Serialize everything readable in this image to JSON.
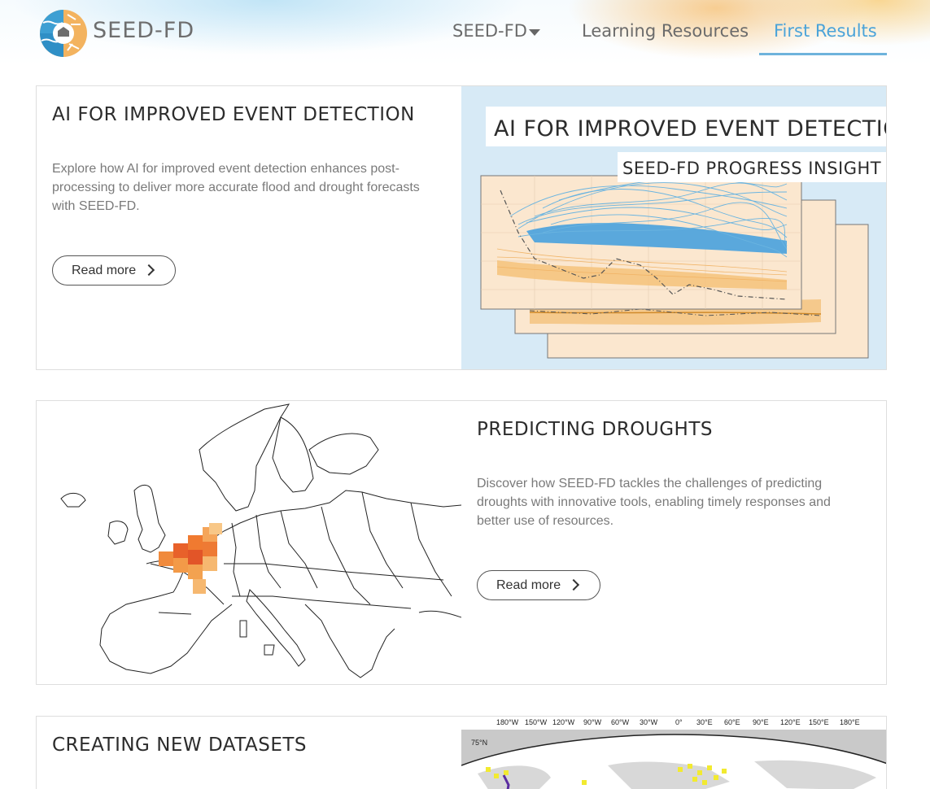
{
  "header": {
    "brand": "SEED-FD",
    "nav": {
      "seedfd_label": "SEED-FD",
      "learning_label": "Learning Resources",
      "first_results_label": "First Results"
    },
    "accent_color": "#4aa3d9"
  },
  "cards": [
    {
      "title": "AI FOR IMPROVED EVENT DETECTION",
      "description": "Explore how AI for improved event detection enhances post-processing to deliver more accurate flood and drought forecasts with SEED-FD.",
      "button_label": "Read more",
      "image": {
        "banner_title": "AI FOR IMPROVED EVENT DETECTION",
        "banner_subtitle": "SEED-FD PROGRESS INSIGHT"
      }
    },
    {
      "title": "PREDICTING DROUGHTS",
      "description": "Discover how SEED-FD tackles the challenges of predicting droughts with innovative tools, enabling timely responses and better use of resources.",
      "button_label": "Read more"
    },
    {
      "title": "CREATING NEW DATASETS",
      "image": {
        "lon_labels": [
          "180°W",
          "150°W",
          "120°W",
          "90°W",
          "60°W",
          "30°W",
          "0°",
          "30°E",
          "60°E",
          "90°E",
          "120°E",
          "150°E",
          "180°E"
        ],
        "lat_label": "75°N"
      }
    }
  ]
}
